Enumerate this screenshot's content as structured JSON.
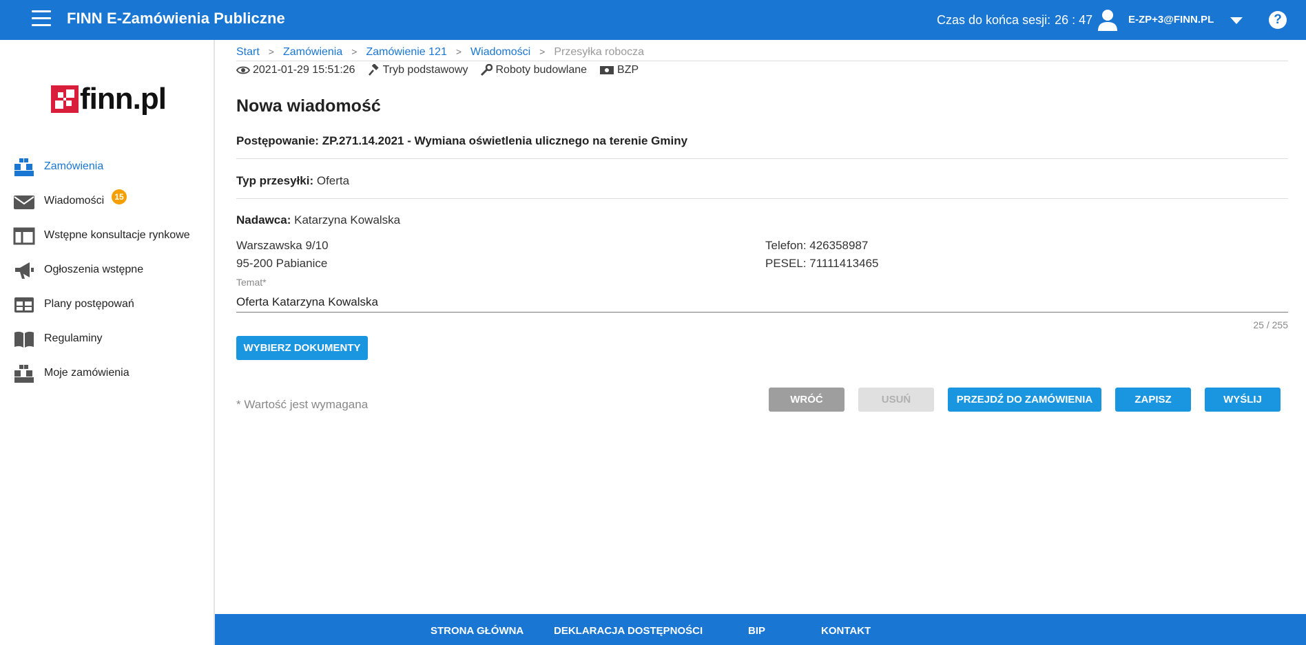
{
  "header": {
    "title": "FINN E-Zamówienia Publiczne",
    "session_label": "Czas do końca sesji:",
    "session_time": "26 : 47",
    "user_email": "E-ZP+3@FINN.PL",
    "help_label": "?"
  },
  "sidebar": {
    "logo_text": "finn.pl",
    "items": [
      {
        "label": "Zamówienia",
        "icon": "boxes-icon",
        "active": true
      },
      {
        "label": "Wiadomości",
        "icon": "envelope-icon",
        "badge": "15"
      },
      {
        "label": "Wstępne konsultacje rynkowe",
        "icon": "columns-icon"
      },
      {
        "label": "Ogłoszenia wstępne",
        "icon": "megaphone-icon"
      },
      {
        "label": "Plany postępowań",
        "icon": "table-icon"
      },
      {
        "label": "Regulaminy",
        "icon": "book-icon"
      },
      {
        "label": "Moje zamówienia",
        "icon": "boxes-icon"
      }
    ]
  },
  "breadcrumb": {
    "items": [
      "Start",
      "Zamówienia",
      "Zamówienie 121",
      "Wiadomości"
    ],
    "current": "Przesyłka robocza"
  },
  "meta": {
    "date": "2021-01-29 15:51:26",
    "mode": "Tryb podstawowy",
    "category": "Roboty budowlane",
    "publication": "BZP"
  },
  "page_title": "Nowa wiadomość",
  "proceeding": {
    "label": "Postępowanie:",
    "value": "ZP.271.14.2021 - Wymiana oświetlenia ulicznego na terenie Gminy"
  },
  "shipment_type": {
    "label": "Typ przesyłki:",
    "value": "Oferta"
  },
  "sender": {
    "label": "Nadawca:",
    "name": "Katarzyna Kowalska",
    "street": "Warszawska 9/10",
    "city": "95-200 Pabianice",
    "phone": "Telefon: 426358987",
    "pesel": "PESEL: 71111413465"
  },
  "subject": {
    "label": "Temat*",
    "value": "Oferta Katarzyna Kowalska",
    "counter": "25 / 255"
  },
  "buttons": {
    "choose_docs": "WYBIERZ DOKUMENTY",
    "back": "WRÓĆ",
    "delete": "USUŃ",
    "goto_order": "PRZEJDŹ DO ZAMÓWIENIA",
    "save": "ZAPISZ",
    "send": "WYŚLIJ"
  },
  "required_note": "* Wartość jest wymagana",
  "footer": {
    "links": [
      "STRONA GŁÓWNA",
      "DEKLARACJA DOSTĘPNOŚCI",
      "BIP",
      "KONTAKT"
    ]
  },
  "colors": {
    "primary": "#1976d2",
    "button": "#1a96e0",
    "badge": "#f5a000",
    "logo_red": "#d81e3a"
  }
}
